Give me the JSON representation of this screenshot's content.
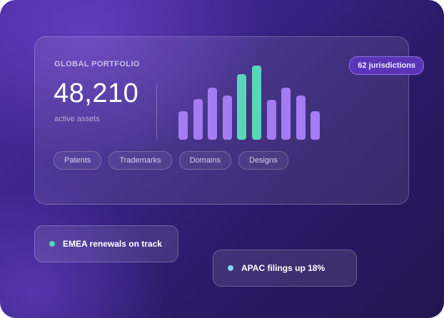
{
  "portfolio": {
    "title": "GLOBAL PORTFOLIO",
    "badge": "62 jurisdictions",
    "total": "48,210",
    "subtitle": "active assets",
    "chips": [
      "Patents",
      "Trademarks",
      "Domains",
      "Designs"
    ]
  },
  "chart_data": {
    "type": "bar",
    "values": [
      38,
      55,
      70,
      60,
      88,
      100,
      54,
      70,
      60,
      38
    ],
    "highlighted_indices": [
      4,
      5
    ],
    "ylim": [
      0,
      100
    ],
    "colors": {
      "default": "#a37cf2",
      "highlight": "#58d6b8"
    }
  },
  "toasts": [
    {
      "text": "EMEA renewals on track",
      "dot_color": "#58d6b8"
    },
    {
      "text": "APAC filings up 18%",
      "dot_color": "#7fd3f7"
    }
  ]
}
